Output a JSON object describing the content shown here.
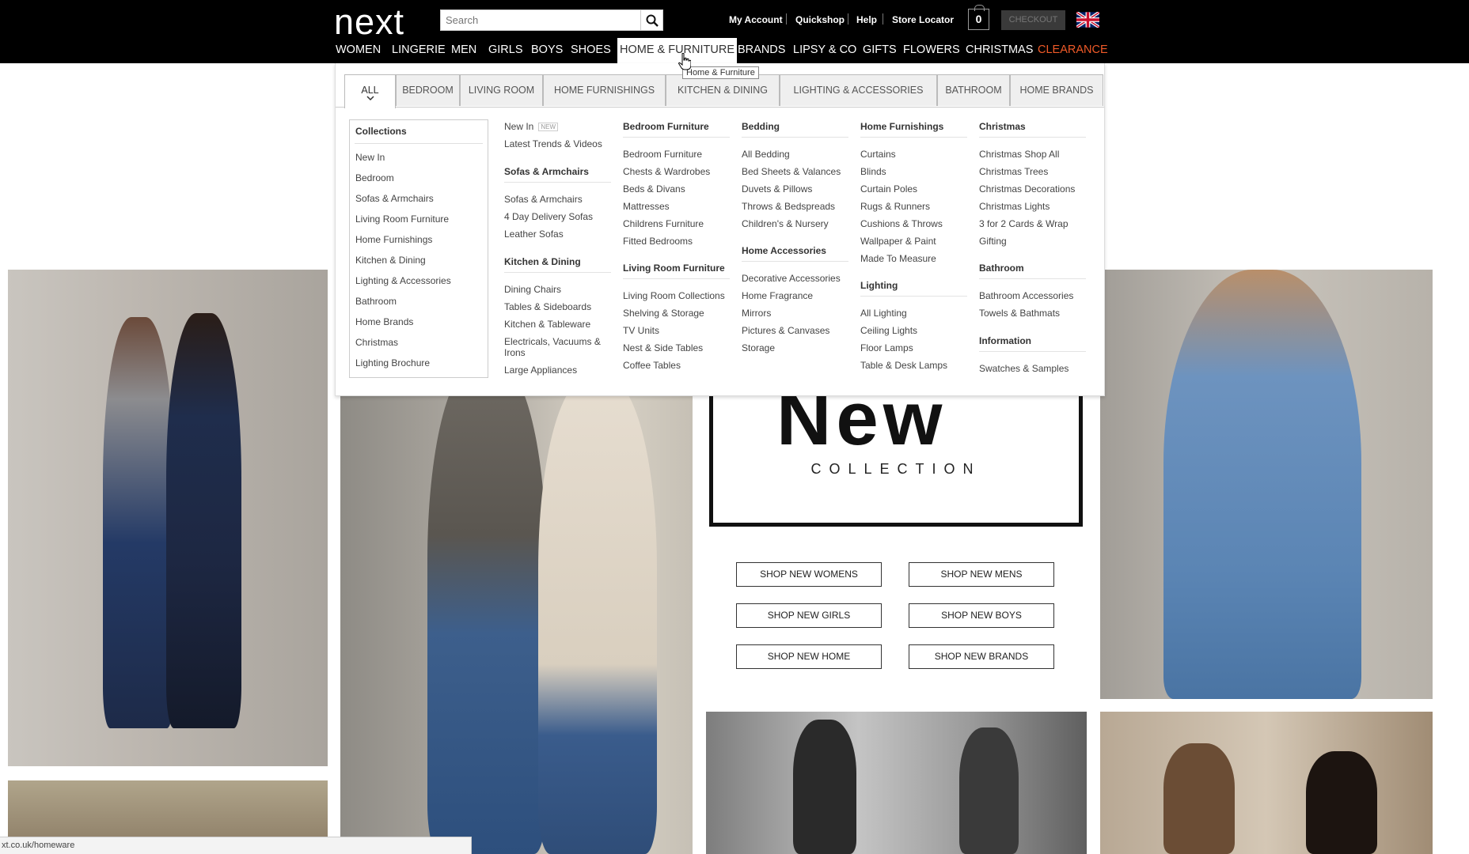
{
  "header": {
    "logo": "next",
    "search_placeholder": "Search",
    "util_links": [
      "My Account",
      "Quickshop",
      "Help",
      "Store Locator"
    ],
    "bag_count": "0",
    "checkout_label": "CHECKOUT"
  },
  "main_nav": {
    "items": [
      "WOMEN",
      "LINGERIE",
      "MEN",
      "GIRLS",
      "BOYS",
      "SHOES",
      "HOME & FURNITURE",
      "BRANDS",
      "LIPSY & CO",
      "GIFTS",
      "FLOWERS",
      "CHRISTMAS",
      "CLEARANCE"
    ],
    "active": "HOME & FURNITURE",
    "tooltip": "Home & Furniture",
    "clearance_color": "#f05a28"
  },
  "mega_menu": {
    "tabs": [
      "ALL",
      "BEDROOM",
      "LIVING ROOM",
      "HOME FURNISHINGS",
      "KITCHEN & DINING",
      "LIGHTING & ACCESSORIES",
      "BATHROOM",
      "HOME BRANDS"
    ],
    "active_tab": "ALL",
    "collections": {
      "title": "Collections",
      "items": [
        "New In",
        "Bedroom",
        "Sofas & Armchairs",
        "Living Room Furniture",
        "Home Furnishings",
        "Kitchen & Dining",
        "Lighting & Accessories",
        "Bathroom",
        "Home Brands",
        "Christmas",
        "Lighting Brochure"
      ]
    },
    "col1": {
      "new_in": "New In",
      "new_badge": "NEW",
      "latest": "Latest Trends & Videos",
      "sofas_head": "Sofas & Armchairs",
      "sofas_links": [
        "Sofas & Armchairs",
        "4 Day Delivery Sofas",
        "Leather Sofas"
      ],
      "kitchen_head": "Kitchen & Dining",
      "kitchen_links": [
        "Dining Chairs",
        "Tables & Sideboards",
        "Kitchen & Tableware",
        "Electricals, Vacuums &",
        "Irons",
        "Large Appliances"
      ]
    },
    "col2": {
      "bedroom_head": "Bedroom Furniture",
      "bedroom_links": [
        "Bedroom Furniture",
        "Chests & Wardrobes",
        "Beds & Divans",
        "Mattresses",
        "Childrens Furniture",
        "Fitted Bedrooms"
      ],
      "living_head": "Living Room Furniture",
      "living_links": [
        "Living Room Collections",
        "Shelving & Storage",
        "TV Units",
        "Nest & Side Tables",
        "Coffee Tables"
      ]
    },
    "col3": {
      "bedding_head": "Bedding",
      "bedding_links": [
        "All Bedding",
        "Bed Sheets & Valances",
        "Duvets & Pillows",
        "Throws & Bedspreads",
        "Children's & Nursery"
      ],
      "acc_head": "Home Accessories",
      "acc_links": [
        "Decorative Accessories",
        "Home Fragrance",
        "Mirrors",
        "Pictures & Canvases",
        "Storage"
      ]
    },
    "col4": {
      "furn_head": "Home Furnishings",
      "furn_links": [
        "Curtains",
        "Blinds",
        "Curtain Poles",
        "Rugs & Runners",
        "Cushions & Throws",
        "Wallpaper & Paint",
        "Made To Measure"
      ],
      "light_head": "Lighting",
      "light_links": [
        "All Lighting",
        "Ceiling Lights",
        "Floor Lamps",
        "Table & Desk Lamps"
      ]
    },
    "col5": {
      "xmas_head": "Christmas",
      "xmas_links": [
        "Christmas Shop All",
        "Christmas Trees",
        "Christmas Decorations",
        "Christmas Lights",
        "3 for 2 Cards & Wrap",
        "Gifting"
      ],
      "bath_head": "Bathroom",
      "bath_links": [
        "Bathroom Accessories",
        "Towels & Bathmats"
      ],
      "info_head": "Information",
      "info_links": [
        "Swatches & Samples"
      ]
    }
  },
  "promo": {
    "headline": "New",
    "subline": "COLLECTION",
    "buttons": [
      "SHOP NEW WOMENS",
      "SHOP NEW MENS",
      "SHOP NEW GIRLS",
      "SHOP NEW BOYS",
      "SHOP NEW HOME",
      "SHOP NEW BRANDS"
    ]
  },
  "status_bar": "xt.co.uk/homeware"
}
